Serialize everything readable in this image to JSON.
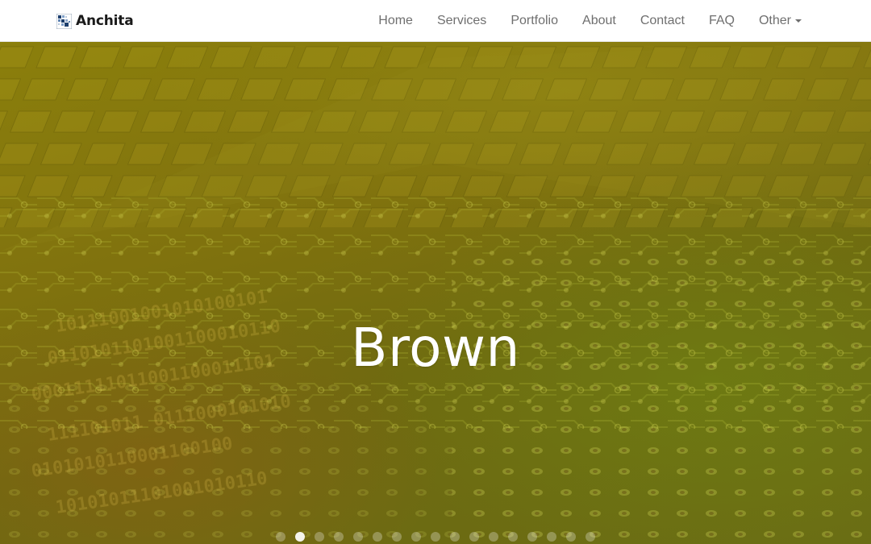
{
  "brand": {
    "name": "Anchita",
    "logo_icon": "pixel-grid-logo"
  },
  "nav": {
    "items": [
      {
        "label": "Home"
      },
      {
        "label": "Services"
      },
      {
        "label": "Portfolio"
      },
      {
        "label": "About"
      },
      {
        "label": "Contact"
      },
      {
        "label": "FAQ"
      },
      {
        "label": "Other",
        "has_dropdown": true
      }
    ]
  },
  "hero": {
    "title": "Brown",
    "background": "circuit-board-image",
    "overlay_color": "#7a7010"
  },
  "carousel": {
    "total_slides": 17,
    "active_index": 1
  },
  "colors": {
    "nav_text": "#6f6f6f",
    "brand_text": "#1a1a1a",
    "hero_text": "#ffffff"
  }
}
